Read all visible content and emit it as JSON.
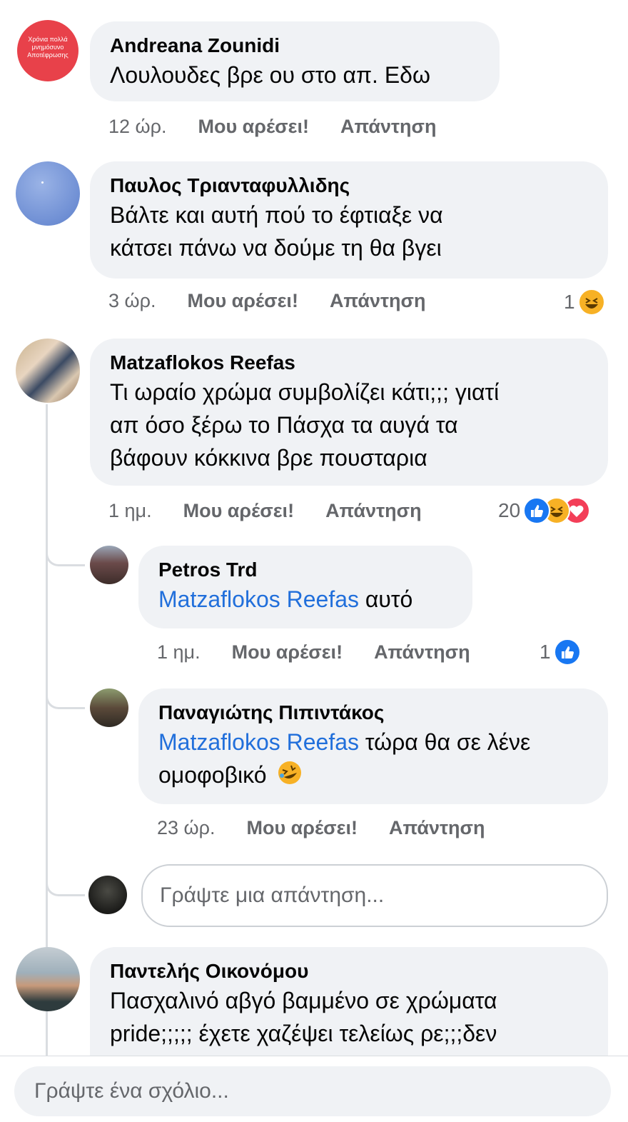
{
  "comments": [
    {
      "author": "Andreana Zounidi",
      "avatar_text": "Χρόνια πολλά μνημόσυνο Αποτέφρωσης",
      "lines": [
        "Λουλουδες βρε ου στο απ. Εδω"
      ],
      "time": "12 ώρ.",
      "like": "Μου αρέσει!",
      "reply": "Απάντηση"
    },
    {
      "author": "Παυλος Τριανταφυλλιδης",
      "lines": [
        "Βάλτε και αυτή πού το έφτιαξε να",
        "κάτσει πάνω να δούμε τη θα βγει"
      ],
      "time": "3 ώρ.",
      "like": "Μου αρέσει!",
      "reply": "Απάντηση",
      "reaction_count": "1",
      "reactions": [
        "haha"
      ]
    },
    {
      "author": "Matzaflokos Reefas",
      "lines": [
        "Τι ωραίο χρώμα συμβολίζει κάτι;;; γιατί",
        "απ όσο ξέρω το Πάσχα τα αυγά τα",
        "βάφουν κόκκινα βρε πουσταρια"
      ],
      "time": "1 ημ.",
      "like": "Μου αρέσει!",
      "reply": "Απάντηση",
      "reaction_count": "20",
      "reactions": [
        "like",
        "haha",
        "love"
      ]
    },
    {
      "author": "Παντελής Οικονόμου",
      "lines": [
        "Πασχαλινό αβγό βαμμένο σε χρώματα",
        "pride;;;;; έχετε χαζέψει τελείως ρε;;;δεν"
      ]
    }
  ],
  "replies": [
    {
      "author": "Petros Trd",
      "mention": "Matzaflokos Reefas",
      "text": " αυτό",
      "time": "1 ημ.",
      "like": "Μου αρέσει!",
      "reply": "Απάντηση",
      "reaction_count": "1",
      "reactions": [
        "like"
      ]
    },
    {
      "author": "Παναγιώτης Πιπιντάκος",
      "mention": "Matzaflokos Reefas",
      "text": " τώρα θα σε λένε",
      "text2": "ομοφοβικό",
      "emoji": "rolling-laughing",
      "time": "23 ώρ.",
      "like": "Μου αρέσει!",
      "reply": "Απάντηση"
    }
  ],
  "reply_input_placeholder": "Γράψτε μια απάντηση...",
  "comment_input_placeholder": "Γράψτε ένα σχόλιο...",
  "colors": {
    "bubble": "#f0f2f5",
    "secondary_text": "#65676b",
    "mention": "#216fdb",
    "like": "#1877f2",
    "haha": "#f7b125",
    "love": "#f33e58"
  }
}
